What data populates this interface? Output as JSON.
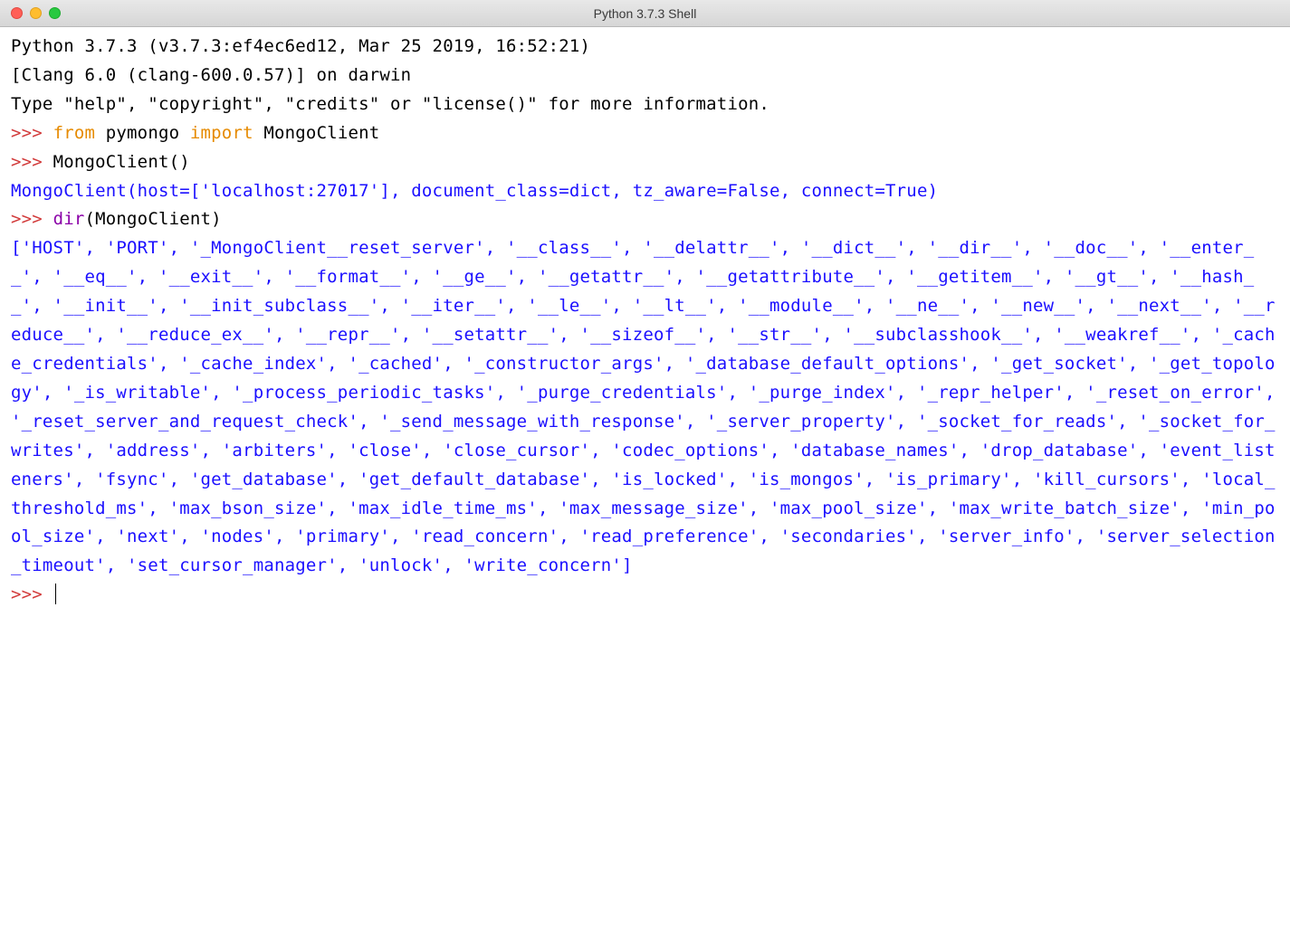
{
  "window": {
    "title": "Python 3.7.3 Shell"
  },
  "prompt": ">>> ",
  "banner": {
    "line1": "Python 3.7.3 (v3.7.3:ef4ec6ed12, Mar 25 2019, 16:52:21) ",
    "line2": "[Clang 6.0 (clang-600.0.57)] on darwin",
    "line3": "Type \"help\", \"copyright\", \"credits\" or \"license()\" for more information."
  },
  "lines": {
    "l1_from": "from",
    "l1_pymongo": " pymongo ",
    "l1_import": "import",
    "l1_mongoclient": " MongoClient",
    "l2_call": "MongoClient()",
    "l2_output": "MongoClient(host=['localhost:27017'], document_class=dict, tz_aware=False, connect=True)",
    "l3_dir": "dir",
    "l3_arg": "(MongoClient)",
    "l3_output": "['HOST', 'PORT', '_MongoClient__reset_server', '__class__', '__delattr__', '__dict__', '__dir__', '__doc__', '__enter__', '__eq__', '__exit__', '__format__', '__ge__', '__getattr__', '__getattribute__', '__getitem__', '__gt__', '__hash__', '__init__', '__init_subclass__', '__iter__', '__le__', '__lt__', '__module__', '__ne__', '__new__', '__next__', '__reduce__', '__reduce_ex__', '__repr__', '__setattr__', '__sizeof__', '__str__', '__subclasshook__', '__weakref__', '_cache_credentials', '_cache_index', '_cached', '_constructor_args', '_database_default_options', '_get_socket', '_get_topology', '_is_writable', '_process_periodic_tasks', '_purge_credentials', '_purge_index', '_repr_helper', '_reset_on_error', '_reset_server_and_request_check', '_send_message_with_response', '_server_property', '_socket_for_reads', '_socket_for_writes', 'address', 'arbiters', 'close', 'close_cursor', 'codec_options', 'database_names', 'drop_database', 'event_listeners', 'fsync', 'get_database', 'get_default_database', 'is_locked', 'is_mongos', 'is_primary', 'kill_cursors', 'local_threshold_ms', 'max_bson_size', 'max_idle_time_ms', 'max_message_size', 'max_pool_size', 'max_write_batch_size', 'min_pool_size', 'next', 'nodes', 'primary', 'read_concern', 'read_preference', 'secondaries', 'server_info', 'server_selection_timeout', 'set_cursor_manager', 'unlock', 'write_concern']"
  }
}
